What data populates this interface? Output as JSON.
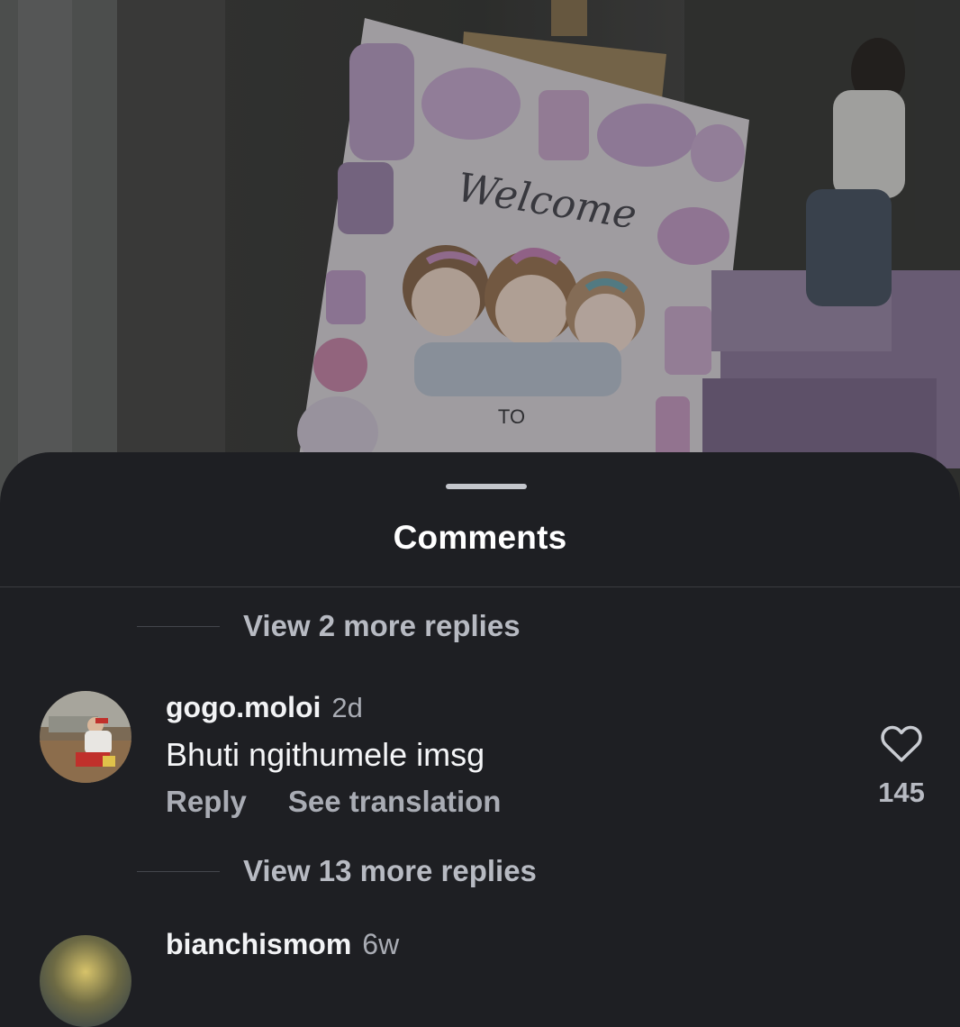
{
  "photo": {
    "sign_title": "Welcome",
    "sign_to": "TO",
    "accent_color": "#c9a6d6"
  },
  "sheet": {
    "title": "Comments"
  },
  "comments": {
    "replies_top": "View 2 more replies",
    "items": [
      {
        "username": "gogo.moloi",
        "time": "2d",
        "text": "Bhuti ngithumele imsg",
        "reply_label": "Reply",
        "translate_label": "See translation",
        "like_icon": "heart-outline-icon",
        "likes": "145"
      }
    ],
    "replies_bottom": "View 13 more replies",
    "next": {
      "username": "bianchismom",
      "time": "6w"
    }
  }
}
